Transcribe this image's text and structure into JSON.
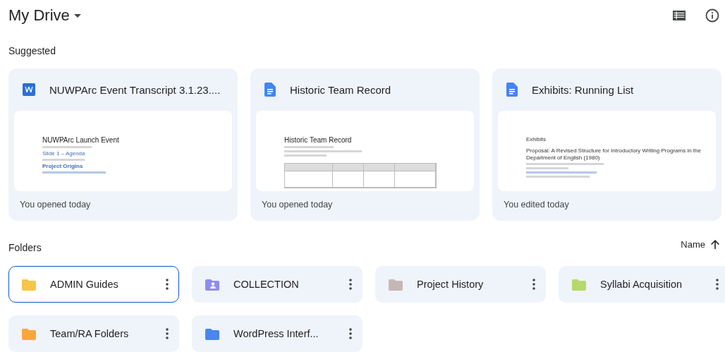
{
  "header": {
    "title": "My Drive"
  },
  "suggested": {
    "label": "Suggested",
    "cards": [
      {
        "kind": "word",
        "name": "NUWPArc Event Transcript 3.1.23....",
        "activity": "You opened today",
        "preview": {
          "lines": [
            {
              "kind": "title",
              "text": "NUWPArc Launch Event"
            },
            {
              "kind": "bar"
            },
            {
              "kind": "link",
              "text": "Slide 1 – Agenda"
            },
            {
              "kind": "bar"
            },
            {
              "kind": "heading",
              "text": "Project Origins"
            },
            {
              "kind": "linkbar"
            }
          ]
        }
      },
      {
        "kind": "docs",
        "name": "Historic Team Record",
        "activity": "You opened today",
        "preview": {
          "lines": [
            {
              "kind": "title",
              "text": "Historic Team Record"
            },
            {
              "kind": "bar"
            },
            {
              "kind": "bar"
            },
            {
              "kind": "bar"
            },
            {
              "kind": "table"
            }
          ]
        }
      },
      {
        "kind": "docs",
        "name": "Exhibits: Running List",
        "activity": "You edited today",
        "preview": {
          "lines": [
            {
              "kind": "small",
              "text": "Exhibits"
            },
            {
              "kind": "body",
              "text": "Proposal: A Revised Structure for Introductory Writing Programs in the Department of English (1980)"
            },
            {
              "kind": "bar"
            },
            {
              "kind": "bar"
            },
            {
              "kind": "linkbar"
            },
            {
              "kind": "bar"
            }
          ]
        }
      }
    ]
  },
  "folders": {
    "label": "Folders",
    "sort": {
      "label": "Name",
      "ascending": true
    },
    "items": [
      {
        "name": "ADMIN Guides",
        "kind": "plain",
        "color": "#f6c54a",
        "selected": true
      },
      {
        "name": "COLLECTION",
        "kind": "shared",
        "color": "#8f8cf3",
        "selected": false
      },
      {
        "name": "Project History",
        "kind": "plain",
        "color": "#c6b7b7",
        "selected": false
      },
      {
        "name": "Syllabi Acquisition",
        "kind": "plain",
        "color": "#b6d96c",
        "selected": false
      },
      {
        "name": "Team/RA Folders",
        "kind": "plain",
        "color": "#f9a73c",
        "selected": false
      },
      {
        "name": "WordPress Interf...",
        "kind": "plain",
        "color": "#4a86f0",
        "selected": false
      }
    ]
  }
}
